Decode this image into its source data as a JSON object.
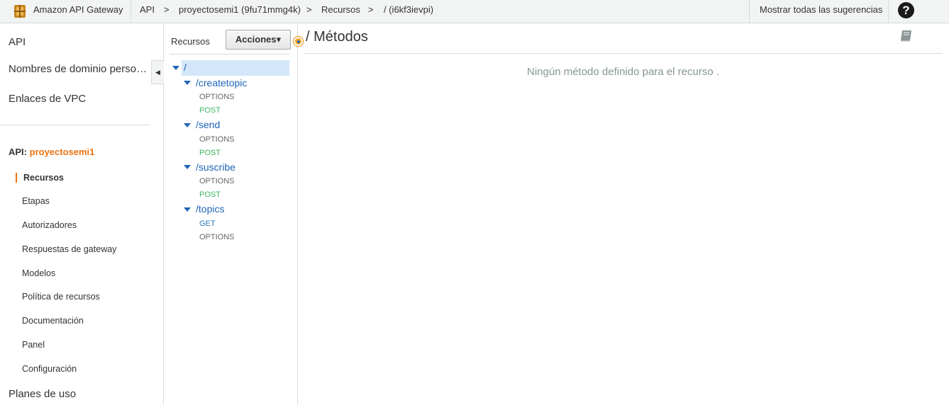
{
  "topbar": {
    "service_name": "Amazon API Gateway",
    "breadcrumb": {
      "api": "API",
      "sep1": ">",
      "api_name": "proyectosemi1 (9fu71mmg4k)",
      "sep2": ">",
      "resources": "Recursos",
      "sep3": ">",
      "current": "/ (i6kf3ievpi)"
    },
    "suggestions": "Mostrar todas las sugerencias",
    "help": "?"
  },
  "leftnav": {
    "top_items": [
      "API",
      "Nombres de dominio perso…",
      "Enlaces de VPC"
    ],
    "api_label": "API:",
    "api_name": "proyectosemi1",
    "sub_items": [
      "Recursos",
      "Etapas",
      "Autorizadores",
      "Respuestas de gateway",
      "Modelos",
      "Política de recursos",
      "Documentación",
      "Panel",
      "Configuración"
    ],
    "bottom_item": "Planes de uso",
    "collapse_glyph": "◀"
  },
  "resources_panel": {
    "title": "Recursos",
    "actions_label": "Acciones▾",
    "tree": [
      {
        "path": "/",
        "methods": []
      },
      {
        "path": "/createtopic",
        "methods": [
          "OPTIONS",
          "POST"
        ]
      },
      {
        "path": "/send",
        "methods": [
          "OPTIONS",
          "POST"
        ]
      },
      {
        "path": "/suscribe",
        "methods": [
          "OPTIONS",
          "POST"
        ]
      },
      {
        "path": "/topics",
        "methods": [
          "GET",
          "OPTIONS"
        ]
      }
    ]
  },
  "main": {
    "title": "/ Métodos",
    "empty_message": "Ningún método definido para el recurso ."
  },
  "colors": {
    "accent_orange": "#ec7211",
    "link_blue": "#1f64b8",
    "post_green": "#3eb55f",
    "get_blue": "#2a7bbd",
    "selected_bg": "#d4e7fa"
  }
}
